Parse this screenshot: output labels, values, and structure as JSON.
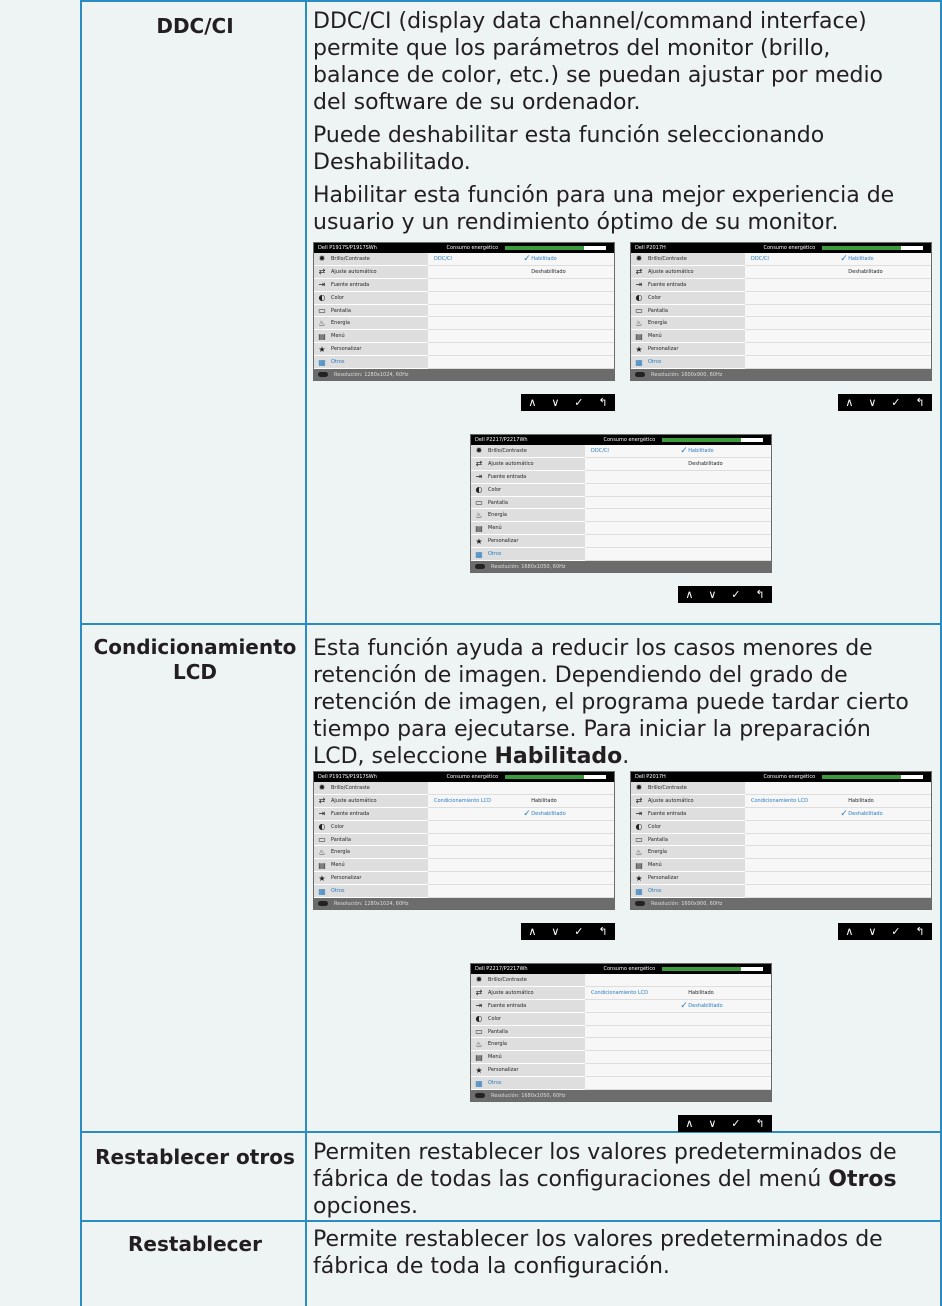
{
  "rows": [
    {
      "label": "DDC/CI",
      "paragraphs": [
        "DDC/CI (display data channel/command interface) permite que los parámetros del monitor (brillo, balance de color, etc.) se puedan ajustar por medio del software de su ordenador.",
        "Puede deshabilitar esta función seleccionando Deshabilitado.",
        "Habilitar esta función para una mejor experiencia de usuario y un rendimiento óptimo de su monitor."
      ]
    },
    {
      "label_line1": "Condicionamiento",
      "label_line2": "LCD",
      "text": "Esta función ayuda a reducir los casos menores de retención de imagen. Dependiendo del grado de retención de imagen, el programa puede tardar cierto tiempo para ejecutarse. Para iniciar la preparación LCD, seleccione ",
      "bold": "Habilitado",
      "tail": "."
    },
    {
      "label": "Restablecer otros",
      "text": "Permiten restablecer los valores predeterminados de fábrica de todas las configuraciones del menú ",
      "bold": "Otros",
      "tail": " opciones."
    },
    {
      "label": "Restablecer",
      "text": "Permite restablecer los valores predeterminados de fábrica de toda la configuración."
    }
  ],
  "osd": {
    "models": [
      "Dell P1917S/P1917SWh",
      "Dell P2017H",
      "Dell P2217/P2217Wh"
    ],
    "consumo": "Consumo energético",
    "energy_level": 0.78,
    "menu": [
      "Brillo/Contraste",
      "Ajuste automático",
      "Fuente entrada",
      "Color",
      "Pantalla",
      "Energía",
      "Menú",
      "Personalizar",
      "Otros"
    ],
    "resolutions": [
      "Resolución: 1280x1024, 60Hz",
      "Resolución: 1600x900, 60Hz",
      "Resolución: 1680x1050, 60Hz"
    ],
    "ddc_key": "DDC/CI",
    "lcd_key": "Condicionamiento LCD",
    "opt_on": "Habilitado",
    "opt_off": "Deshabilitado",
    "check": "✓",
    "nav": [
      "∧",
      "∨",
      "✓",
      "↰"
    ]
  }
}
